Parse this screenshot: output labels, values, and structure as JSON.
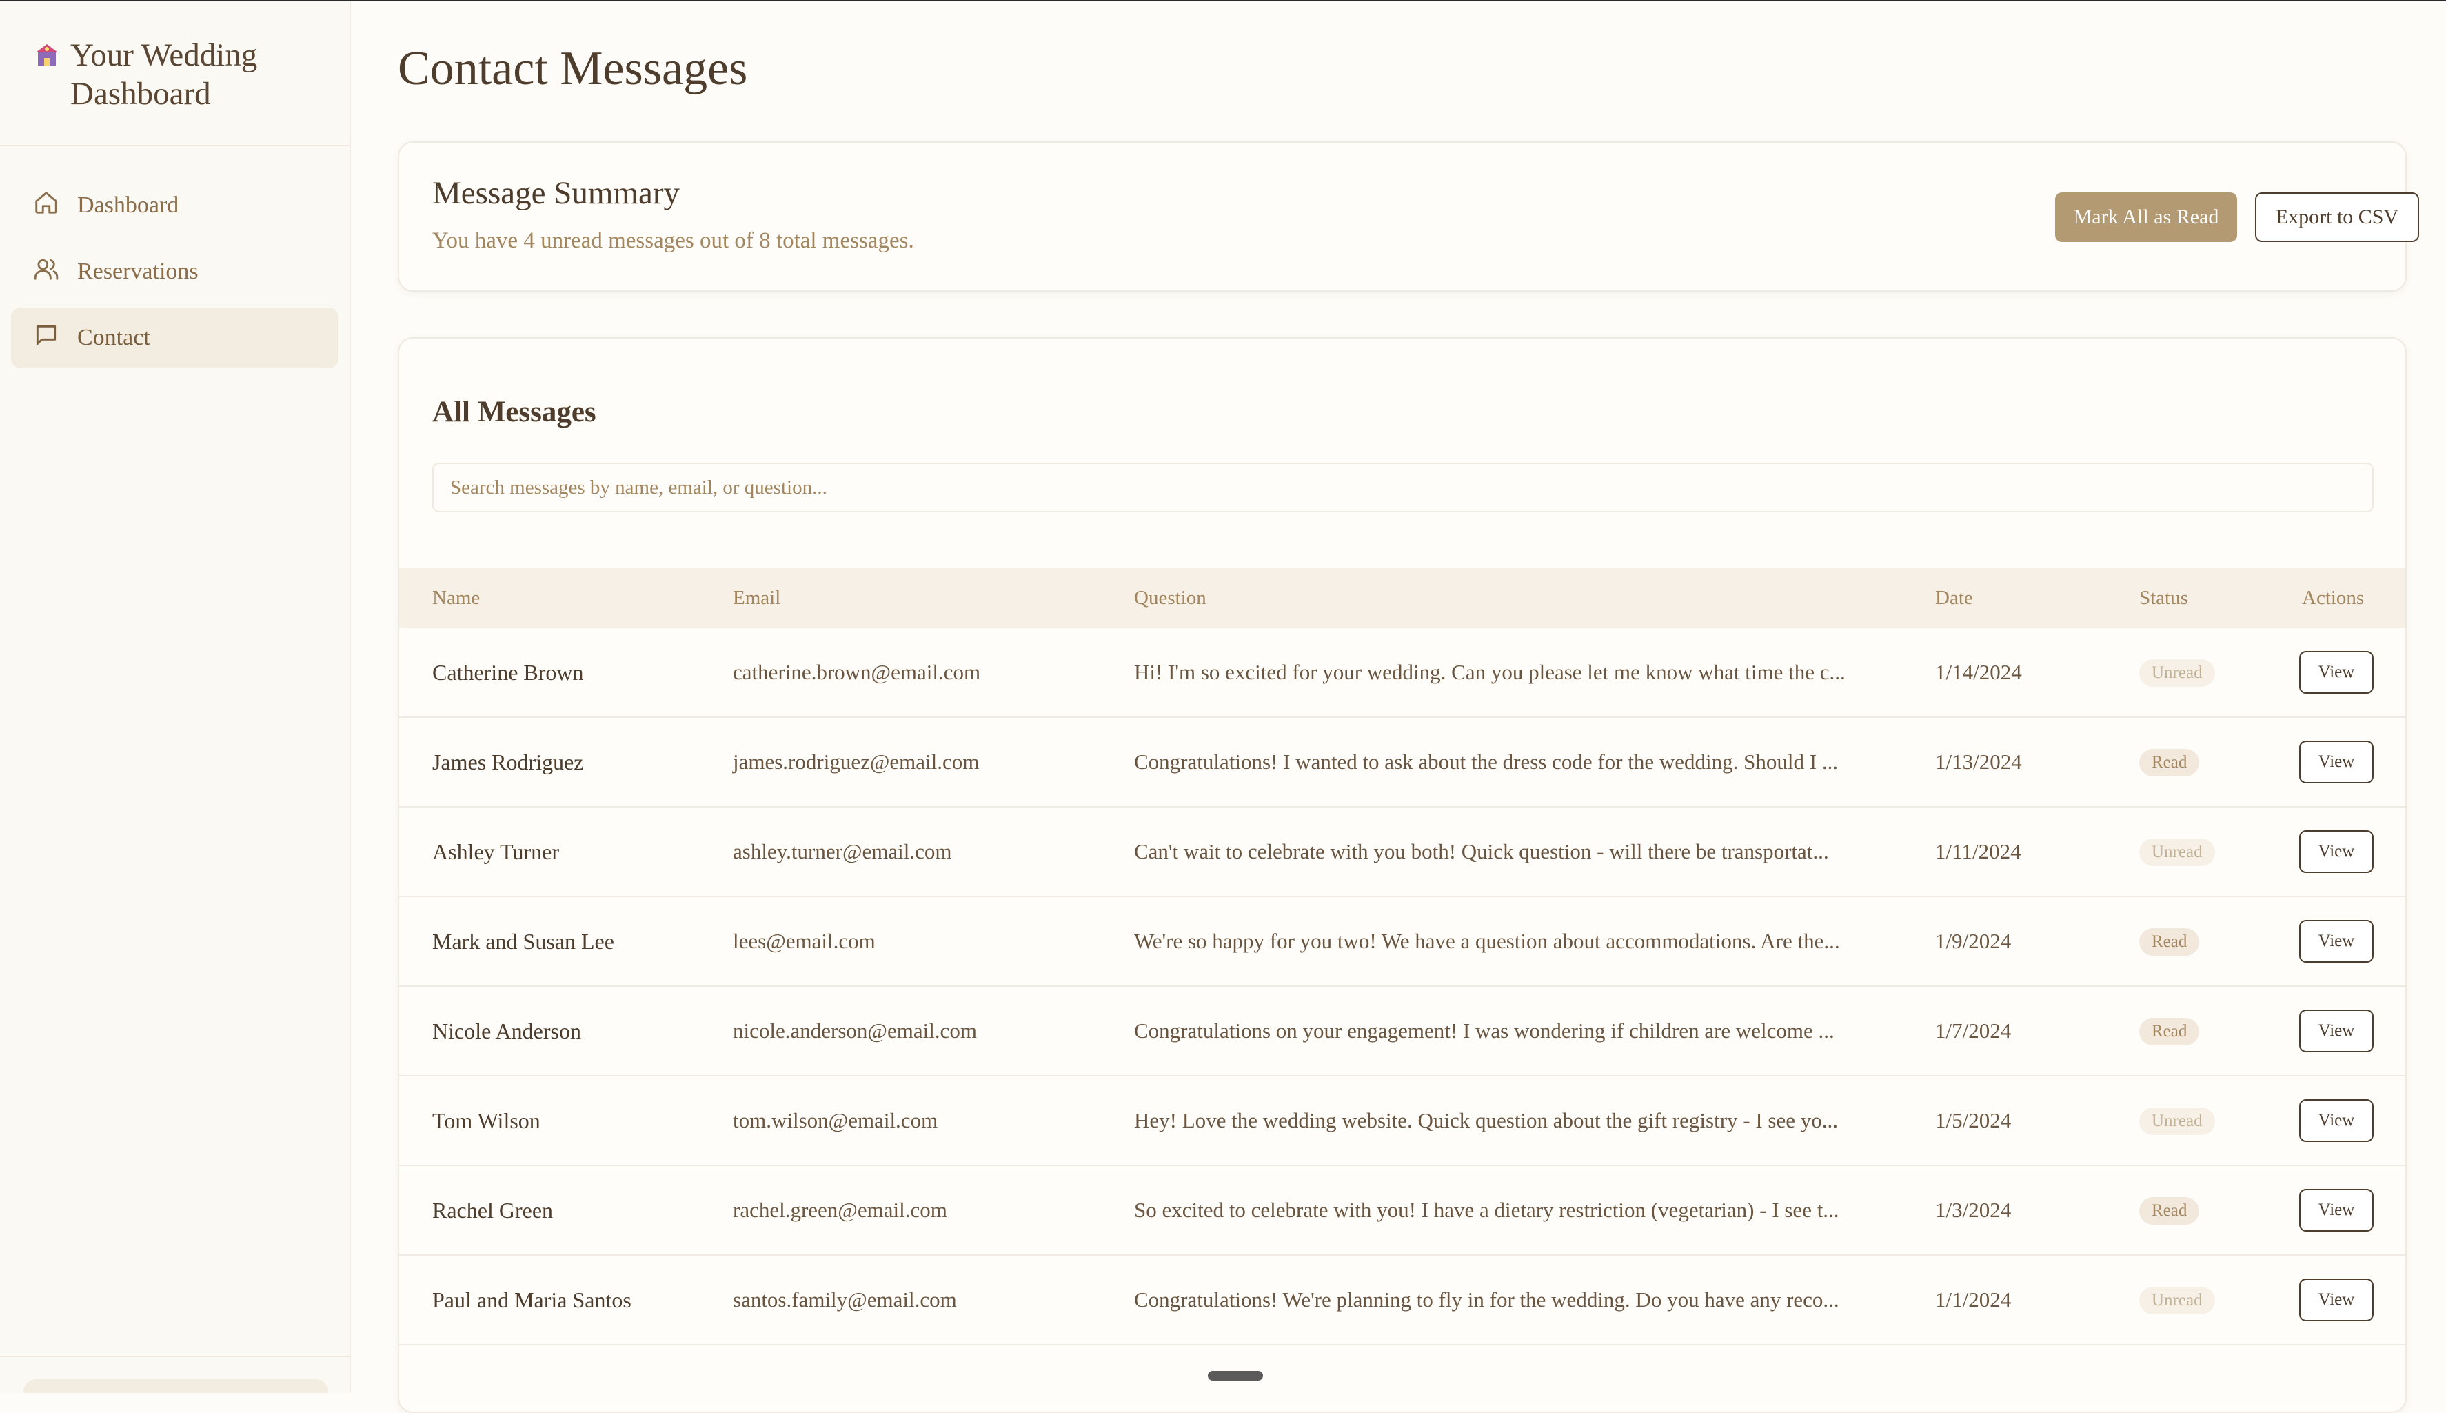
{
  "sidebar": {
    "brand_title": "Your Wedding Dashboard",
    "items": [
      {
        "label": "Dashboard",
        "icon": "home-icon",
        "active": false
      },
      {
        "label": "Reservations",
        "icon": "users-icon",
        "active": false
      },
      {
        "label": "Contact",
        "icon": "message-icon",
        "active": true
      }
    ]
  },
  "page": {
    "title": "Contact Messages"
  },
  "summary": {
    "title": "Message Summary",
    "text": "You have 4 unread messages out of 8 total messages.",
    "mark_all_label": "Mark All as Read",
    "export_label": "Export to CSV"
  },
  "messages": {
    "title": "All Messages",
    "search_placeholder": "Search messages by name, email, or question...",
    "columns": [
      "Name",
      "Email",
      "Question",
      "Date",
      "Status",
      "Actions"
    ],
    "view_label": "View",
    "rows": [
      {
        "name": "Catherine Brown",
        "email": "catherine.brown@email.com",
        "question": "Hi! I'm so excited for your wedding. Can you please let me know what time the c...",
        "date": "1/14/2024",
        "status": "Unread"
      },
      {
        "name": "James Rodriguez",
        "email": "james.rodriguez@email.com",
        "question": "Congratulations! I wanted to ask about the dress code for the wedding. Should I ...",
        "date": "1/13/2024",
        "status": "Read"
      },
      {
        "name": "Ashley Turner",
        "email": "ashley.turner@email.com",
        "question": "Can't wait to celebrate with you both! Quick question - will there be transportat...",
        "date": "1/11/2024",
        "status": "Unread"
      },
      {
        "name": "Mark and Susan Lee",
        "email": "lees@email.com",
        "question": "We're so happy for you two! We have a question about accommodations. Are the...",
        "date": "1/9/2024",
        "status": "Read"
      },
      {
        "name": "Nicole Anderson",
        "email": "nicole.anderson@email.com",
        "question": "Congratulations on your engagement! I was wondering if children are welcome ...",
        "date": "1/7/2024",
        "status": "Read"
      },
      {
        "name": "Tom Wilson",
        "email": "tom.wilson@email.com",
        "question": "Hey! Love the wedding website. Quick question about the gift registry - I see yo...",
        "date": "1/5/2024",
        "status": "Unread"
      },
      {
        "name": "Rachel Green",
        "email": "rachel.green@email.com",
        "question": "So excited to celebrate with you! I have a dietary restriction (vegetarian) - I see t...",
        "date": "1/3/2024",
        "status": "Read"
      },
      {
        "name": "Paul and Maria Santos",
        "email": "santos.family@email.com",
        "question": "Congratulations! We're planning to fly in for the wedding. Do you have any reco...",
        "date": "1/1/2024",
        "status": "Unread"
      }
    ]
  },
  "colors": {
    "accent": "#b39a72",
    "text": "#4e3d2c",
    "muted": "#a4865e",
    "background": "#fdfcf8"
  }
}
